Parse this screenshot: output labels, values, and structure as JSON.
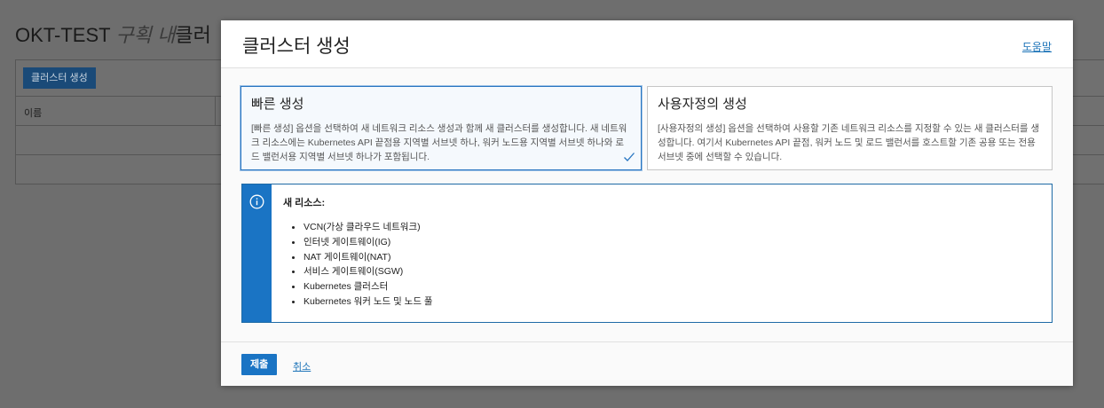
{
  "background": {
    "title": "OKT-TEST",
    "compartment": "구획 내",
    "title_suffix": "클러",
    "create_button": "클러스터 생성",
    "table": {
      "column_name": "이름"
    }
  },
  "modal": {
    "title": "클러스터 생성",
    "help_link": "도움말",
    "options": [
      {
        "title": "빠른 생성",
        "description": "[빠른 생성] 옵션을 선택하여 새 네트워크 리소스 생성과 함께 새 클러스터를 생성합니다. 새 네트워크 리소스에는 Kubernetes API 끝점용 지역별 서브넷 하나, 워커 노드용 지역별 서브넷 하나와 로드 밸런서용 지역별 서브넷 하나가 포함됩니다.",
        "selected": true
      },
      {
        "title": "사용자정의 생성",
        "description": "[사용자정의 생성] 옵션을 선택하여 사용할 기존 네트워크 리소스를 지정할 수 있는 새 클러스터를 생성합니다. 여기서 Kubernetes API 끝점, 워커 노드 및 로드 밸런서를 호스트할 기존 공용 또는 전용 서브넷 중에 선택할 수 있습니다.",
        "selected": false
      }
    ],
    "info": {
      "heading": "새 리소스:",
      "items": [
        "VCN(가상 클라우드 네트워크)",
        "인터넷 게이트웨이(IG)",
        "NAT 게이트웨이(NAT)",
        "서비스 게이트웨이(SGW)",
        "Kubernetes 클러스터",
        "Kubernetes 워커 노드 및 노드 풀"
      ]
    },
    "footer": {
      "submit_label": "제출",
      "cancel_label": "취소"
    }
  },
  "colors": {
    "accent": "#1a74c4",
    "link": "#1c73b8",
    "overlay": "#6e6e6e"
  }
}
